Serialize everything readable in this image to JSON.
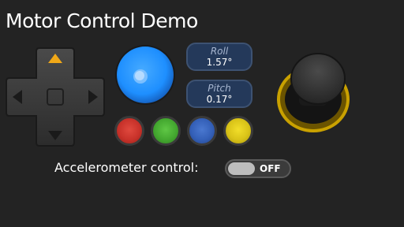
{
  "app": {
    "title": "Motor Control Demo"
  },
  "dpad": {
    "buttons": [
      "up",
      "down",
      "left",
      "right",
      "center"
    ],
    "active": "up",
    "active_color": "#f0a818"
  },
  "orb": {
    "color": "#1e8fff"
  },
  "readouts": {
    "roll_label": "Roll",
    "roll_value": "1.57°",
    "pitch_label": "Pitch",
    "pitch_value": "0.17°"
  },
  "color_buttons": [
    {
      "name": "red",
      "color": "#c8322a"
    },
    {
      "name": "green",
      "color": "#44a830"
    },
    {
      "name": "blue",
      "color": "#3460b8"
    },
    {
      "name": "yellow",
      "color": "#d9c318"
    }
  ],
  "accelerometer": {
    "label": "Accelerometer control:",
    "toggle_state": "OFF"
  },
  "joystick": {
    "ring_color": "#c9a100"
  }
}
